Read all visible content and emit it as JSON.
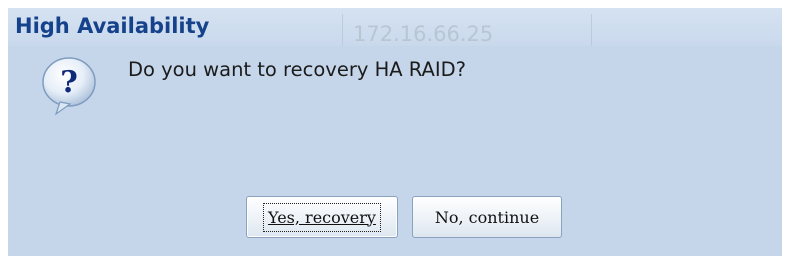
{
  "dialog": {
    "title": "High Availability",
    "background_fragment": "172.16.66.25",
    "icon": "question-icon",
    "message": "Do you want to recovery HA RAID?",
    "buttons": {
      "yes_label": "Yes, recovery",
      "no_label": "No, continue"
    },
    "colors": {
      "title": "#15428b",
      "body_background": "#c5d6ea",
      "header_background": "#cddcee"
    }
  }
}
